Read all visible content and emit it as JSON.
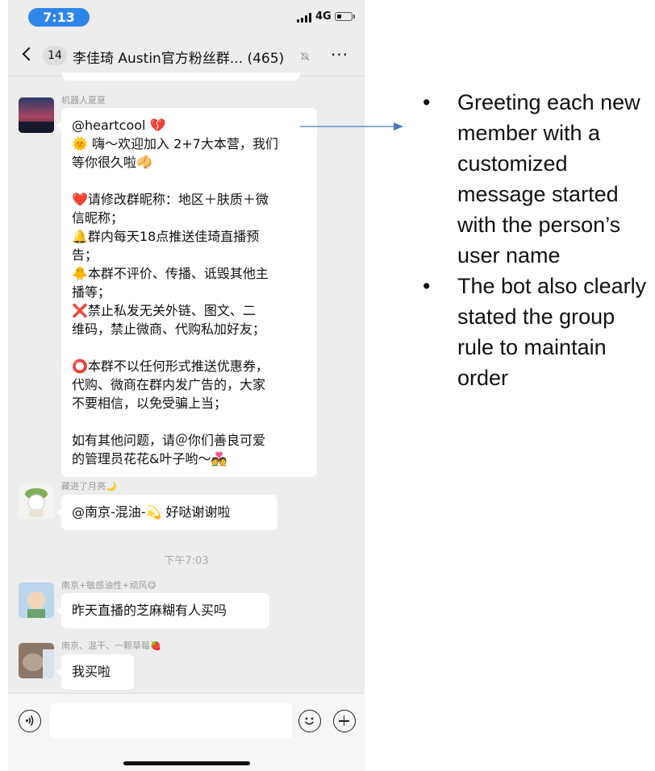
{
  "status_bar": {
    "time": "7:13",
    "network": "4G"
  },
  "nav": {
    "unread_count": "14",
    "title": "李佳琦 Austin官方粉丝群... (465)",
    "more": "···"
  },
  "messages": [
    {
      "sender": "机器人夏夏",
      "lines": [
        "@heartcool 💔",
        "🌞 嗨～欢迎加入 2+7大本营，我们",
        "等你很久啦🥠",
        "",
        "❤️请修改群昵称：地区＋肤质＋微",
        "信昵称；",
        "🔔群内每天18点推送佳琦直播预",
        "告；",
        "🐥本群不评价、传播、诋毁其他主",
        "播等；",
        "❌禁止私发无关外链、图文、二",
        "维码，禁止微商、代购私加好友；",
        "",
        "⭕本群不以任何形式推送优惠券，",
        "代购、微商在群内发广告的，大家",
        "不要相信，以免受骗上当；",
        "",
        "如有其他问题，请＠你们善良可爱",
        "的管理员花花&叶子哟～💑"
      ]
    },
    {
      "sender": "藏进了月亮🌙",
      "text": "@南京-混油-💫 好哒谢谢啦"
    },
    {
      "sender": "南京+敏感油性+顽风😋",
      "text": "昨天直播的芝麻糊有人买吗"
    },
    {
      "sender": "南京、混干、一颗草莓🍓",
      "text": "我买啦"
    }
  ],
  "timestamp": "下午7:03",
  "annotation": {
    "points": [
      "Greeting each new member with a customized message started with the person’s user name",
      "The bot also clearly stated the group rule to maintain order"
    ]
  }
}
